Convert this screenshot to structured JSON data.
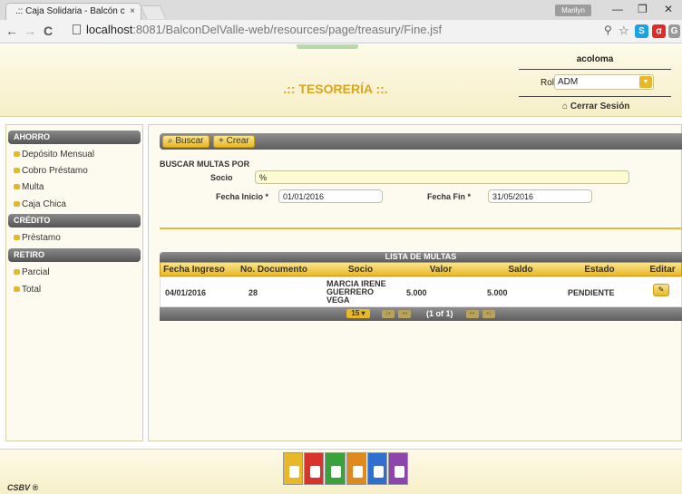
{
  "browser": {
    "tab_title": ".:: Caja Solidaria - Balcón c",
    "tab_close": "×",
    "user_badge": "Marilyn",
    "url_host": "localhost",
    "url_rest": ":8081/BalconDelValle-web/resources/page/treasury/Fine.jsf",
    "win_min": "—",
    "win_max": "❐",
    "win_close": "✕"
  },
  "header": {
    "title": ".:: TESORERÍA ::.",
    "username": "acoloma",
    "rol_label": "Rol",
    "rol_value": "ADM",
    "logout": "Cerrar Sesión",
    "logout_icon": "⌂"
  },
  "sidebar": {
    "sections": [
      {
        "title": "AHORRO",
        "items": [
          "Depósito Mensual",
          "Cobro Préstamo",
          "Multa",
          "Caja Chica"
        ]
      },
      {
        "title": "CRÉDITO",
        "items": [
          "Prèstamo"
        ]
      },
      {
        "title": "RETIRO",
        "items": [
          "Parcial",
          "Total"
        ]
      }
    ]
  },
  "toolbar": {
    "search_label": "Buscar",
    "search_icon": "⌕",
    "create_label": "Crear",
    "create_icon": "+"
  },
  "form": {
    "title": "BUSCAR MULTAS POR",
    "socio_label": "Socio",
    "socio_value": "%",
    "fecha_inicio_label": "Fecha Inicio *",
    "fecha_inicio_value": "01/01/2016",
    "fecha_fin_label": "Fecha Fin *",
    "fecha_fin_value": "31/05/2016"
  },
  "table": {
    "title": "LISTA DE MULTAS",
    "columns": [
      "Fecha Ingreso",
      "No. Documento",
      "Socio",
      "Valor",
      "Saldo",
      "Estado",
      "Editar"
    ],
    "rows": [
      {
        "fecha": "04/01/2016",
        "documento": "28",
        "socio_1": "MARCIA IRENE",
        "socio_2": "GUERRERO",
        "socio_3": "VEGA",
        "valor": "5.000",
        "saldo": "5.000",
        "estado": "PENDIENTE"
      }
    ],
    "rows_per_page": "15 ▾",
    "page_info": "(1 of 1)"
  },
  "footer": {
    "copyright": "CSBV ®",
    "app_colors": [
      "#e8b829",
      "#d9342b",
      "#3aa23a",
      "#e08a1e",
      "#2f6fcf",
      "#8e44ad"
    ]
  }
}
